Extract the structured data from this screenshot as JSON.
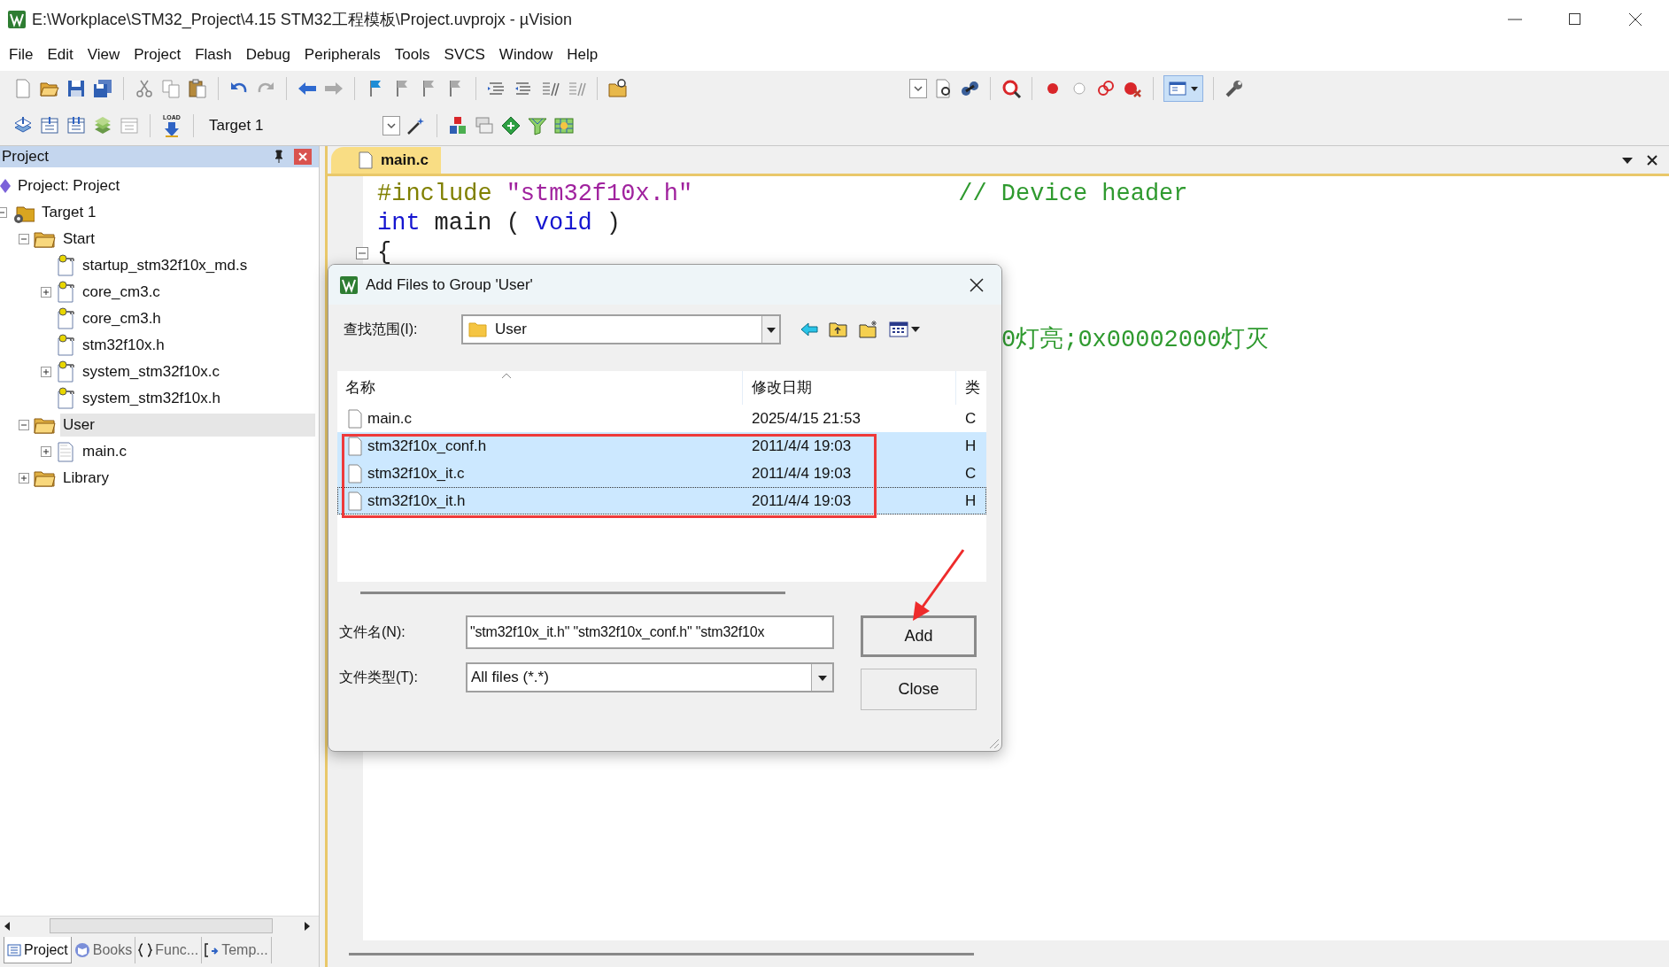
{
  "window": {
    "title": "E:\\Workplace\\STM32_Project\\4.15 STM32工程模板\\Project.uvprojx - µVision"
  },
  "menu": [
    "File",
    "Edit",
    "View",
    "Project",
    "Flash",
    "Debug",
    "Peripherals",
    "Tools",
    "SVCS",
    "Window",
    "Help"
  ],
  "build_toolbar": {
    "load_label": "LOAD",
    "target": "Target 1"
  },
  "project_panel": {
    "title": "Project",
    "tree": [
      {
        "label": "Project: Project",
        "kind": "project",
        "selected": false,
        "children": [
          {
            "label": "Target 1",
            "kind": "target",
            "expanded": true,
            "selected": false,
            "children": [
              {
                "label": "Start",
                "kind": "group",
                "expanded": true,
                "selected": false,
                "children": [
                  {
                    "label": "startup_stm32f10x_md.s",
                    "kind": "file",
                    "locked": true,
                    "selected": false
                  },
                  {
                    "label": "core_cm3.c",
                    "kind": "file",
                    "locked": true,
                    "expanded": false,
                    "selected": false
                  },
                  {
                    "label": "core_cm3.h",
                    "kind": "file",
                    "locked": true,
                    "selected": false
                  },
                  {
                    "label": "stm32f10x.h",
                    "kind": "file",
                    "locked": true,
                    "selected": false
                  },
                  {
                    "label": "system_stm32f10x.c",
                    "kind": "file",
                    "locked": true,
                    "expanded": false,
                    "selected": false
                  },
                  {
                    "label": "system_stm32f10x.h",
                    "kind": "file",
                    "locked": true,
                    "selected": false
                  }
                ]
              },
              {
                "label": "User",
                "kind": "group",
                "expanded": true,
                "selected": true,
                "children": [
                  {
                    "label": "main.c",
                    "kind": "file",
                    "locked": false,
                    "expanded": false,
                    "selected": false
                  }
                ]
              },
              {
                "label": "Library",
                "kind": "group",
                "expanded": false,
                "selected": false
              }
            ]
          }
        ]
      }
    ],
    "tabs": [
      {
        "label": "Project",
        "selected": true
      },
      {
        "label": "Books",
        "selected": false
      },
      {
        "label": "Func...",
        "selected": false
      },
      {
        "label": "Temp...",
        "selected": false
      }
    ]
  },
  "editor": {
    "tabs": [
      {
        "label": "main.c",
        "selected": true
      }
    ],
    "lines": [
      {
        "segments": [
          {
            "kind": "preprocessor",
            "text": "#include"
          },
          {
            "kind": "string",
            "text": "\"stm32f10x.h\""
          },
          {
            "kind": "comment",
            "text": "// Device header"
          }
        ]
      },
      {
        "segments": [
          {
            "kind": "keyword",
            "text": "int"
          },
          {
            "kind": "plain",
            "text": "main ("
          },
          {
            "kind": "keyword",
            "text": "void"
          },
          {
            "kind": "plain",
            "text": ")"
          }
        ]
      },
      {
        "fold": true,
        "segments": [
          {
            "kind": "plain",
            "text": "{"
          }
        ]
      }
    ],
    "partial_line": {
      "kind": "comment",
      "text": "0灯亮;0x00002000灯灭"
    }
  },
  "dialog": {
    "title": "Add Files to Group 'User'",
    "look_in_label": "查找范围(I):",
    "look_in": "User",
    "columns": [
      "名称",
      "修改日期",
      "类"
    ],
    "files": [
      {
        "name": "main.c",
        "modified": "2025/4/15 21:53",
        "type": "C",
        "selected": false
      },
      {
        "name": "stm32f10x_conf.h",
        "modified": "2011/4/4 19:03",
        "type": "H",
        "selected": true
      },
      {
        "name": "stm32f10x_it.c",
        "modified": "2011/4/4 19:03",
        "type": "C",
        "selected": true
      },
      {
        "name": "stm32f10x_it.h",
        "modified": "2011/4/4 19:03",
        "type": "H",
        "selected": true
      }
    ],
    "file_name_label": "文件名(N):",
    "file_name": "\"stm32f10x_it.h\" \"stm32f10x_conf.h\" \"stm32f10x",
    "file_type_label": "文件类型(T):",
    "file_type": "All files (*.*)",
    "buttons": [
      {
        "label": "Add",
        "default": true
      },
      {
        "label": "Close",
        "default": false
      }
    ]
  }
}
